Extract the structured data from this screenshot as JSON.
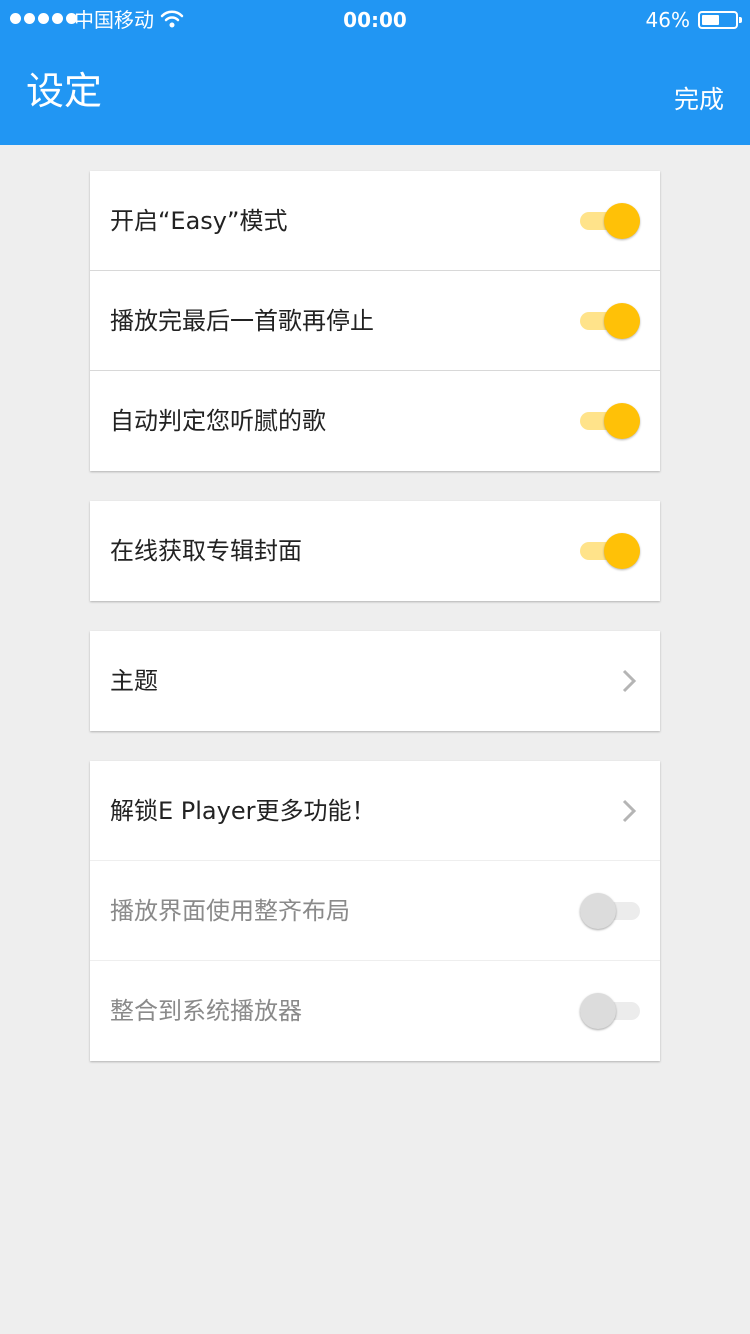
{
  "status_bar": {
    "carrier": "中国移动",
    "time": "00:00",
    "battery": "46%",
    "battery_level": 0.46
  },
  "header": {
    "title": "设定",
    "done_label": "完成"
  },
  "colors": {
    "header_bg": "#2196f3",
    "toggle_on": "#ffc107",
    "toggle_on_track": "#ffe38a",
    "toggle_off": "#dcdcdc"
  },
  "settings": {
    "easy_mode": {
      "label": "开启“Easy”模式",
      "state": "on"
    },
    "stop_after_last": {
      "label": "播放完最后一首歌再停止",
      "state": "on"
    },
    "auto_detect_tired": {
      "label": "自动判定您听腻的歌",
      "state": "on"
    },
    "online_cover": {
      "label": "在线获取专辑封面",
      "state": "on"
    },
    "theme": {
      "label": "主题",
      "icon": "chevron-right-icon"
    },
    "unlock_more": {
      "label": "解锁E Player更多功能！",
      "icon": "chevron-right-icon"
    },
    "tidy_layout": {
      "label": "播放界面使用整齐布局",
      "state": "off"
    },
    "system_player": {
      "label": "整合到系统播放器",
      "state": "off"
    }
  }
}
